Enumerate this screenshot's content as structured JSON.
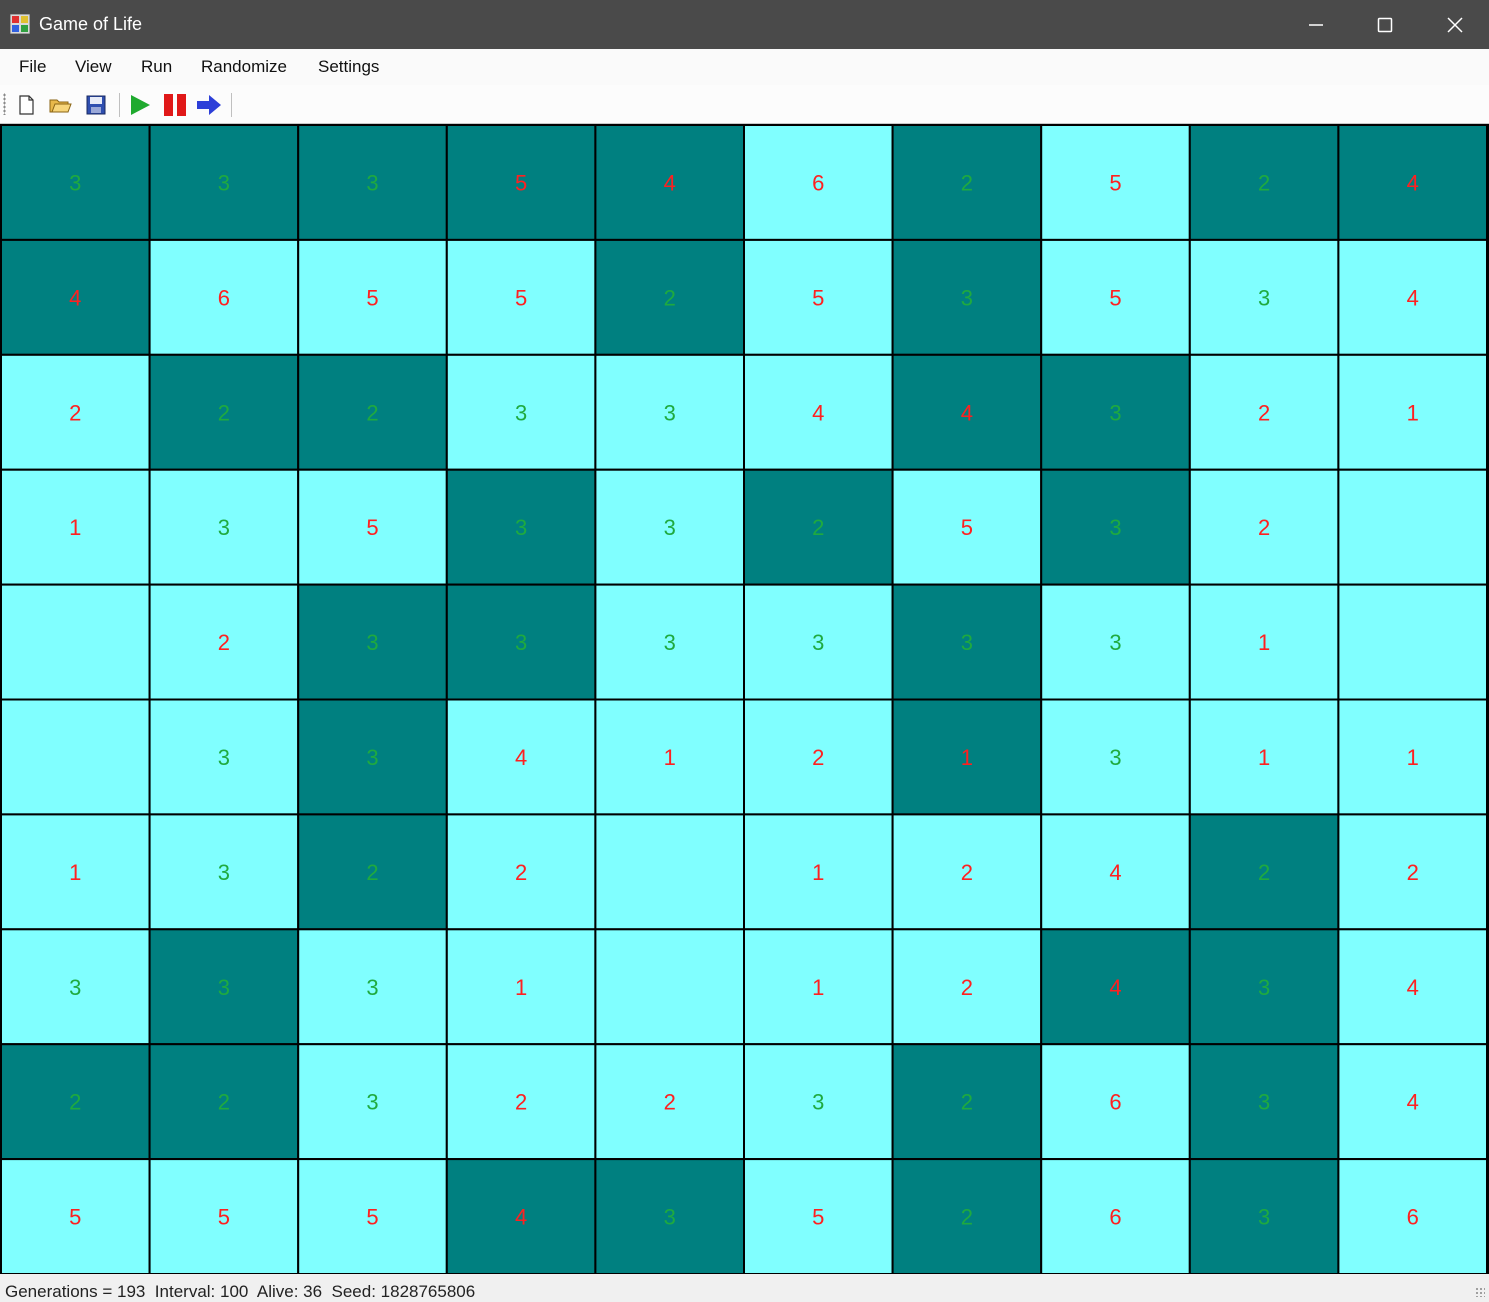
{
  "window": {
    "title": "Game of Life",
    "minimize": "minimize-icon",
    "maximize": "maximize-icon",
    "close": "close-icon"
  },
  "menu": [
    "File",
    "View",
    "Run",
    "Randomize",
    "Settings"
  ],
  "toolbar": {
    "buttons": [
      "new-icon",
      "open-icon",
      "save-icon",
      "play-icon",
      "pause-icon",
      "next-icon"
    ]
  },
  "colors": {
    "alive": "#008080",
    "dead": "#80ffff",
    "grid_line": "#000000",
    "num_live": "#1faa3f",
    "num_die": "#ff2020"
  },
  "universe": {
    "alive": [
      [
        1,
        1,
        1,
        1,
        1,
        0,
        1,
        0,
        1,
        1
      ],
      [
        1,
        0,
        0,
        0,
        1,
        0,
        1,
        0,
        0,
        0
      ],
      [
        0,
        1,
        1,
        0,
        0,
        0,
        1,
        1,
        0,
        0
      ],
      [
        0,
        0,
        0,
        1,
        0,
        1,
        0,
        1,
        0,
        0
      ],
      [
        0,
        0,
        1,
        1,
        0,
        0,
        1,
        0,
        0,
        0
      ],
      [
        0,
        0,
        1,
        0,
        0,
        0,
        1,
        0,
        0,
        0
      ],
      [
        0,
        0,
        1,
        0,
        0,
        0,
        0,
        0,
        1,
        0
      ],
      [
        0,
        1,
        0,
        0,
        0,
        0,
        0,
        1,
        1,
        0
      ],
      [
        1,
        1,
        0,
        0,
        0,
        0,
        1,
        0,
        1,
        0
      ],
      [
        0,
        0,
        0,
        1,
        1,
        0,
        1,
        0,
        1,
        0
      ]
    ],
    "neighbors": [
      [
        3,
        3,
        3,
        5,
        4,
        6,
        2,
        5,
        2,
        4
      ],
      [
        4,
        6,
        5,
        5,
        2,
        5,
        3,
        5,
        3,
        4
      ],
      [
        2,
        2,
        2,
        3,
        3,
        4,
        4,
        3,
        2,
        1
      ],
      [
        1,
        3,
        5,
        3,
        3,
        2,
        5,
        3,
        2,
        0
      ],
      [
        0,
        2,
        3,
        3,
        3,
        3,
        3,
        3,
        1,
        0
      ],
      [
        0,
        3,
        3,
        4,
        1,
        2,
        1,
        3,
        1,
        1
      ],
      [
        1,
        3,
        2,
        2,
        0,
        1,
        2,
        4,
        2,
        2
      ],
      [
        3,
        3,
        3,
        1,
        0,
        1,
        2,
        4,
        3,
        4
      ],
      [
        2,
        2,
        3,
        2,
        2,
        3,
        2,
        6,
        3,
        4
      ],
      [
        5,
        5,
        5,
        4,
        3,
        5,
        2,
        6,
        3,
        6
      ]
    ]
  },
  "status": {
    "text": "Generations = 193  Interval: 100  Alive: 36  Seed: 1828765806"
  }
}
